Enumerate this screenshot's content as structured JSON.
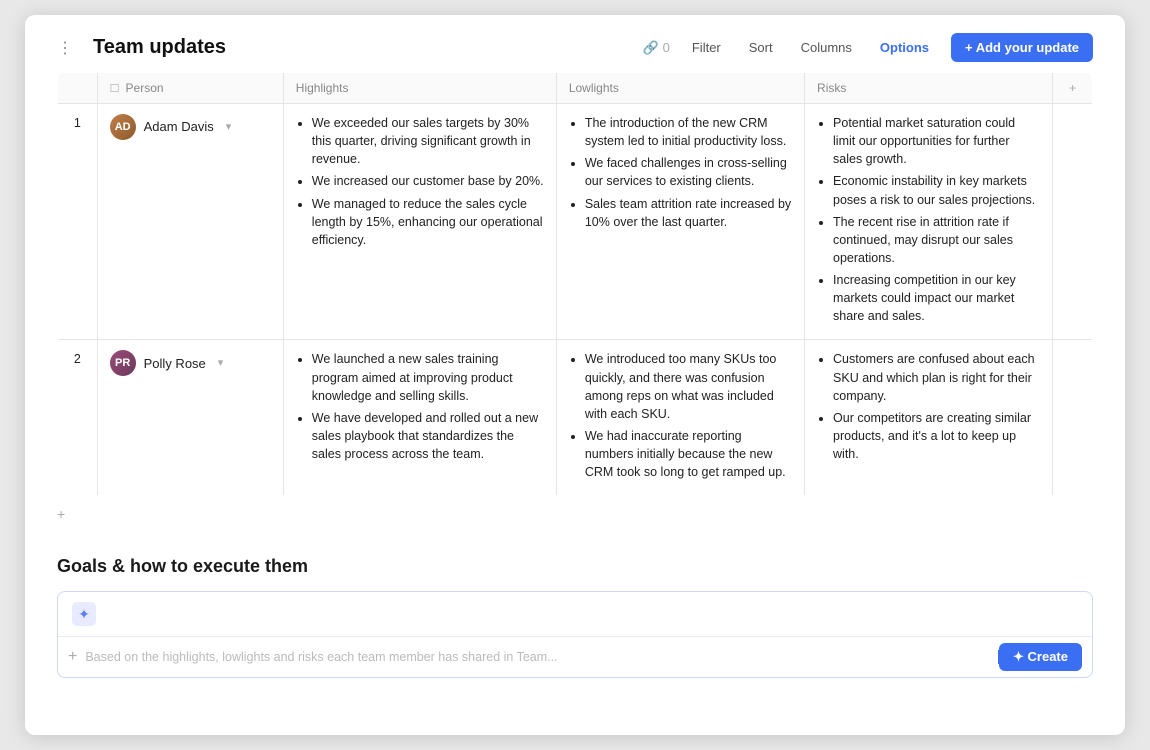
{
  "window": {
    "title": "Team updates"
  },
  "header": {
    "title": "Team updates",
    "link_count": "0",
    "filter_label": "Filter",
    "sort_label": "Sort",
    "columns_label": "Columns",
    "options_label": "Options",
    "add_update_label": "+ Add your update"
  },
  "table": {
    "columns": [
      {
        "id": "person",
        "label": "Person",
        "icon": "checkbox"
      },
      {
        "id": "highlights",
        "label": "Highlights"
      },
      {
        "id": "lowlights",
        "label": "Lowlights"
      },
      {
        "id": "risks",
        "label": "Risks"
      }
    ],
    "rows": [
      {
        "num": "1",
        "person": {
          "name": "Adam Davis",
          "initials": "AD",
          "avatar_class": "avatar-ad"
        },
        "highlights": [
          "We exceeded our sales targets by 30% this quarter, driving significant growth in revenue.",
          "We increased our customer base by 20%.",
          "We managed to reduce the sales cycle length by 15%, enhancing our operational efficiency."
        ],
        "lowlights": [
          "The introduction of the new CRM system led to initial productivity loss.",
          "We faced challenges in cross-selling our services to existing clients.",
          "Sales team attrition rate increased by 10% over the last quarter."
        ],
        "risks": [
          "Potential market saturation could limit our opportunities for further sales growth.",
          "Economic instability in key markets poses a risk to our sales projections.",
          "The recent rise in attrition rate if continued, may disrupt our sales operations.",
          "Increasing competition in our key markets could impact our market share and sales."
        ]
      },
      {
        "num": "2",
        "person": {
          "name": "Polly Rose",
          "initials": "PR",
          "avatar_class": "avatar-pr"
        },
        "highlights": [
          "We launched a new sales training program aimed at improving product knowledge and selling skills.",
          "We have developed and rolled out a new sales playbook that standardizes the sales process across the team."
        ],
        "lowlights": [
          "We introduced too many SKUs too quickly, and there was confusion among reps on what was included with each SKU.",
          "We had inaccurate reporting numbers initially because the new CRM took so long to get ramped up."
        ],
        "risks": [
          "Customers are confused about each SKU and which plan is right for their company.",
          "Our competitors are creating similar products, and it's a lot to keep up with."
        ]
      }
    ]
  },
  "goals_section": {
    "title": "Goals & how to execute them",
    "ai_icon": "✦",
    "plus_icon": "+",
    "placeholder": "Based on the highlights, lowlights and risks each team member has shared in Team...",
    "create_label": "✦ Create"
  }
}
